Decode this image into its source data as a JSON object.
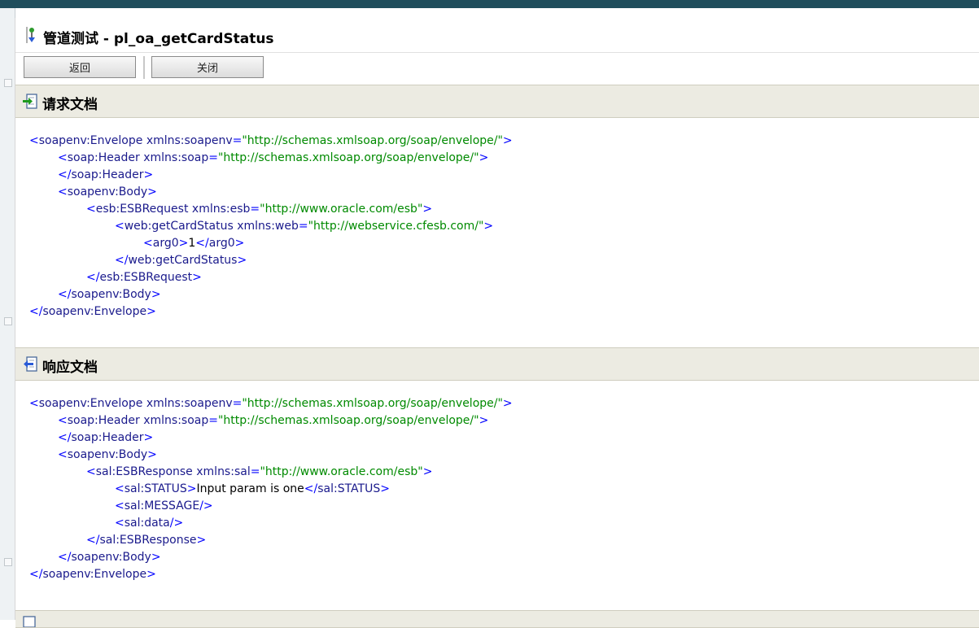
{
  "title": "管道测试 - pl_oa_getCardStatus",
  "toolbar": {
    "back_label": "返回",
    "close_label": "关闭"
  },
  "request_section": {
    "title": "请求文档",
    "lines": [
      {
        "indent": 0,
        "kind": "open",
        "tag": "soapenv:Envelope",
        "attr_name": "xmlns:soapenv",
        "attr_value": "\"http://schemas.xmlsoap.org/soap/envelope/\""
      },
      {
        "indent": 1,
        "kind": "open",
        "tag": "soap:Header",
        "attr_name": "xmlns:soap",
        "attr_value": "\"http://schemas.xmlsoap.org/soap/envelope/\""
      },
      {
        "indent": 1,
        "kind": "close",
        "tag": "soap:Header"
      },
      {
        "indent": 1,
        "kind": "open",
        "tag": "soapenv:Body"
      },
      {
        "indent": 2,
        "kind": "open",
        "tag": "esb:ESBRequest",
        "attr_name": "xmlns:esb",
        "attr_value": "\"http://www.oracle.com/esb\""
      },
      {
        "indent": 3,
        "kind": "open",
        "tag": "web:getCardStatus",
        "attr_name": "xmlns:web",
        "attr_value": "\"http://webservice.cfesb.com/\""
      },
      {
        "indent": 4,
        "kind": "element",
        "tag": "arg0",
        "text": "1"
      },
      {
        "indent": 3,
        "kind": "close",
        "tag": "web:getCardStatus"
      },
      {
        "indent": 2,
        "kind": "close",
        "tag": "esb:ESBRequest"
      },
      {
        "indent": 1,
        "kind": "close",
        "tag": "soapenv:Body"
      },
      {
        "indent": 0,
        "kind": "close",
        "tag": "soapenv:Envelope"
      }
    ]
  },
  "response_section": {
    "title": "响应文档",
    "lines": [
      {
        "indent": 0,
        "kind": "open",
        "tag": "soapenv:Envelope",
        "attr_name": "xmlns:soapenv",
        "attr_value": "\"http://schemas.xmlsoap.org/soap/envelope/\""
      },
      {
        "indent": 1,
        "kind": "open",
        "tag": "soap:Header",
        "attr_name": "xmlns:soap",
        "attr_value": "\"http://schemas.xmlsoap.org/soap/envelope/\""
      },
      {
        "indent": 1,
        "kind": "close",
        "tag": "soap:Header"
      },
      {
        "indent": 1,
        "kind": "open",
        "tag": "soapenv:Body"
      },
      {
        "indent": 2,
        "kind": "open",
        "tag": "sal:ESBResponse",
        "attr_name": "xmlns:sal",
        "attr_value": "\"http://www.oracle.com/esb\""
      },
      {
        "indent": 3,
        "kind": "element",
        "tag": "sal:STATUS",
        "text": "Input param is one"
      },
      {
        "indent": 3,
        "kind": "empty",
        "tag": "sal:MESSAGE"
      },
      {
        "indent": 3,
        "kind": "empty",
        "tag": "sal:data"
      },
      {
        "indent": 2,
        "kind": "close",
        "tag": "sal:ESBResponse"
      },
      {
        "indent": 1,
        "kind": "close",
        "tag": "soapenv:Body"
      },
      {
        "indent": 0,
        "kind": "close",
        "tag": "soapenv:Envelope"
      }
    ]
  },
  "icons": {
    "title": "pipeline-test-icon",
    "request": "request-document-icon",
    "response": "response-document-icon"
  }
}
